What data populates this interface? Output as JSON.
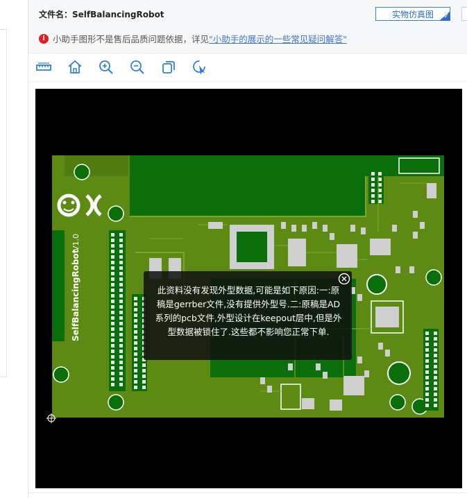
{
  "header": {
    "file_label": "文件名：",
    "file_name": "SelfBalancingRobot",
    "sim_button": "实物仿真图"
  },
  "notice": {
    "icon": "exclamation-circle-icon",
    "text": "小助手图形不是售后品质问题依据，详见",
    "link": "\"小助手的展示的一些常见疑问解答\""
  },
  "toolbar": {
    "tools": [
      "ruler-icon",
      "home-icon",
      "zoom-in-icon",
      "zoom-out-icon",
      "copy-icon",
      "pointer-icon"
    ]
  },
  "pcb": {
    "silk_name": "SelfBalancingRobot",
    "silk_version": "V1.0",
    "colors": {
      "board": "#5c8a12",
      "copper": "#0a6e0a",
      "silk": "#ffffff",
      "pad": "#bfbfbf"
    }
  },
  "overlay": {
    "message": "此资料没有发现外型数据,可能是如下原因:一:原稿是gerrber文件,没有提供外型号.二:原稿是AD系列的pcb文件,外型设计在keepout层中,但是外型数据被锁住了.这些都不影响您正常下单."
  }
}
